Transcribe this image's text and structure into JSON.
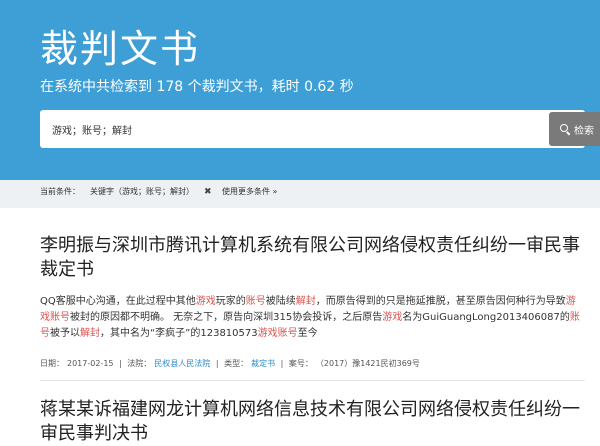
{
  "header": {
    "title": "裁判文书",
    "subtitle": "在系统中共检索到 178 个裁判文书，耗时 0.62 秒",
    "bg_color": "#3d9fd6"
  },
  "search": {
    "value": "游戏；账号；解封",
    "button_label": "检索",
    "button_icon": "search-icon"
  },
  "filters": {
    "label": "当前条件：",
    "condition": "关键字（游戏；账号；解封）",
    "remove_symbol": "✖",
    "more_label": "使用更多条件 »"
  },
  "results": [
    {
      "title": "李明振与深圳市腾讯计算机系统有限公司网络侵权责任纠纷一审民事裁定书",
      "snippet": [
        {
          "t": "QQ客服中心沟通，在此过程中其他",
          "h": false
        },
        {
          "t": "游戏",
          "h": true
        },
        {
          "t": "玩家的",
          "h": false
        },
        {
          "t": "账号",
          "h": true
        },
        {
          "t": "被陆续",
          "h": false
        },
        {
          "t": "解封",
          "h": true
        },
        {
          "t": "，而原告得到的只是拖延推脱，甚至原告因何种行为导致",
          "h": false
        },
        {
          "t": "游戏账号",
          "h": true
        },
        {
          "t": "被封的原因都不明确。 无奈之下，原告向深圳315协会投诉，之后原告",
          "h": false
        },
        {
          "t": "游戏",
          "h": true
        },
        {
          "t": "名为GuiGuangLong2013406087的",
          "h": false
        },
        {
          "t": "账号",
          "h": true
        },
        {
          "t": "被予以",
          "h": false
        },
        {
          "t": "解封",
          "h": true
        },
        {
          "t": "，其中名为“李疯子”的123810573",
          "h": false
        },
        {
          "t": "游戏账号",
          "h": true
        },
        {
          "t": "至今",
          "h": false
        }
      ],
      "date_label": "日期：",
      "date": "2017-02-15",
      "court_label": "法院：",
      "court": "民权县人民法院",
      "type_label": "类型：",
      "type": "裁定书",
      "case_label": "案号：",
      "case_no": "（2017）豫1421民初369号"
    },
    {
      "title": "蒋某某诉福建网龙计算机网络信息技术有限公司网络侵权责任纠纷一审民事判决书"
    }
  ],
  "colors": {
    "highlight": "#d9534f",
    "link": "#2a8ac8"
  }
}
